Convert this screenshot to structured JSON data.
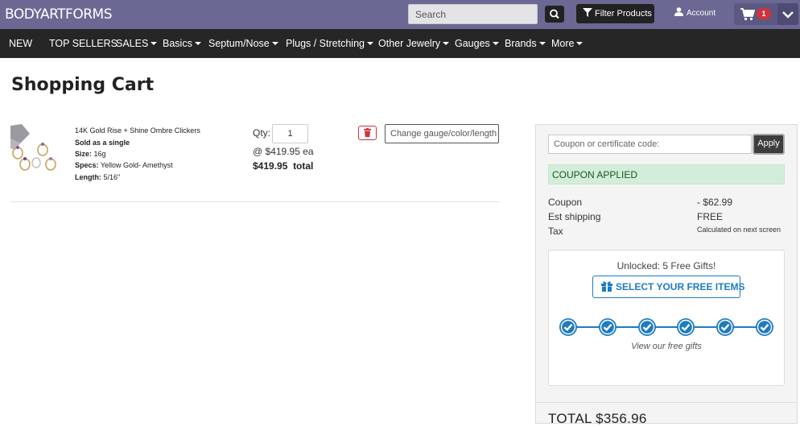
{
  "header": {
    "logo": "BODYARTFORMS",
    "search_placeholder": "Search",
    "filter_label": "Filter Products",
    "account_label": "Account",
    "cart_count": "1"
  },
  "nav": {
    "items": [
      {
        "label": "NEW",
        "dropdown": false
      },
      {
        "label": "TOP SELLERS",
        "dropdown": false
      },
      {
        "label": "SALES",
        "dropdown": true
      },
      {
        "label": "Basics",
        "dropdown": true
      },
      {
        "label": "Septum/Nose",
        "dropdown": true
      },
      {
        "label": "Plugs / Stretching",
        "dropdown": true
      },
      {
        "label": "Other Jewelry",
        "dropdown": true
      },
      {
        "label": "Gauges",
        "dropdown": true
      },
      {
        "label": "Brands",
        "dropdown": true
      },
      {
        "label": "More",
        "dropdown": true
      }
    ]
  },
  "page": {
    "title": "Shopping Cart"
  },
  "cart_item": {
    "name": "14K Gold Rise + Shine Ombre Clickers",
    "sold_as": "Sold as a single",
    "size_label": "Size:",
    "size_value": "16g",
    "specs_label": "Specs:",
    "specs_value": "Yellow Gold- Amethyst",
    "length_label": "Length:",
    "length_value": "5/16\"",
    "qty_label": "Qty:",
    "qty_value": "1",
    "each_price": "@ $419.95 ea",
    "line_total": "$419.95",
    "line_total_label": "total",
    "change_label": "Change gauge/color/length"
  },
  "summary": {
    "coupon_placeholder": "Coupon or certificate code:",
    "apply_label": "Apply",
    "coupon_applied": "COUPON APPLIED",
    "rows": [
      {
        "label": "Coupon",
        "value": "- $62.99"
      },
      {
        "label": "Est shipping",
        "value": "FREE"
      },
      {
        "label": "Tax",
        "value": "Calculated on next screen"
      }
    ],
    "gifts_unlocked": "Unlocked: 5 Free Gifts!",
    "select_gifts_label": "SELECT YOUR FREE ITEMS",
    "view_gifts": "View our free gifts",
    "gift_steps": 6,
    "total_label": "TOTAL",
    "total_value": "$356.96"
  },
  "colors": {
    "header_bg": "#6b6893",
    "nav_bg": "#262626",
    "accent_blue": "#1f7bc0",
    "badge_red": "#d1333a",
    "success_bg": "#d4edda"
  }
}
